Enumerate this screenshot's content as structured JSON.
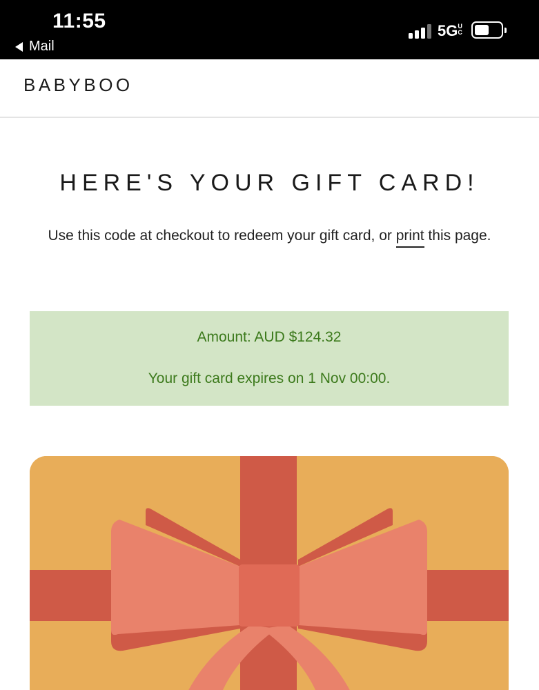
{
  "status_bar": {
    "time": "11:55",
    "back_label": "Mail",
    "network": "5G",
    "network_badge": "UC"
  },
  "header": {
    "logo": "BABYBOO"
  },
  "main": {
    "title": "HERE'S YOUR GIFT CARD!",
    "instructions_before": "Use this code at checkout to redeem your gift card, or ",
    "print_link": "print",
    "instructions_after": " this page.",
    "amount": "Amount: AUD $124.32",
    "expiry": "Your gift card expires on 1 Nov 00:00."
  },
  "colors": {
    "notice_bg": "#d3e5c6",
    "notice_text": "#3c7a1c",
    "card_bg": "#e8ad59",
    "ribbon": "#cf5a47",
    "bow": "#e9826b",
    "knot": "#e06a56"
  },
  "icons": {
    "back": "back-triangle-icon",
    "signal": "cellular-signal-icon",
    "battery": "battery-icon",
    "card_art": "gift-bow-illustration"
  }
}
